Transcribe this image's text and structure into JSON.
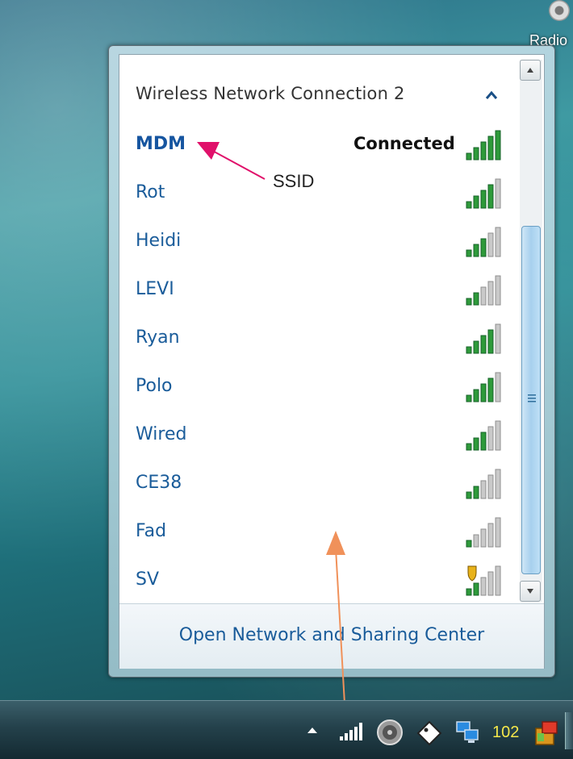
{
  "desktop": {
    "icon_label": "Radio"
  },
  "popup": {
    "section_title": "Wireless Network Connection 2",
    "networks": [
      {
        "ssid": "MDM",
        "status": "Connected",
        "bars": 5,
        "secured_shield": false,
        "connected": true
      },
      {
        "ssid": "Rot",
        "status": "",
        "bars": 4,
        "secured_shield": false,
        "connected": false
      },
      {
        "ssid": "Heidi",
        "status": "",
        "bars": 3,
        "secured_shield": false,
        "connected": false
      },
      {
        "ssid": "LEVI",
        "status": "",
        "bars": 2,
        "secured_shield": false,
        "connected": false
      },
      {
        "ssid": "Ryan",
        "status": "",
        "bars": 4,
        "secured_shield": false,
        "connected": false
      },
      {
        "ssid": "Polo",
        "status": "",
        "bars": 4,
        "secured_shield": false,
        "connected": false
      },
      {
        "ssid": "Wired",
        "status": "",
        "bars": 3,
        "secured_shield": false,
        "connected": false
      },
      {
        "ssid": "CE38",
        "status": "",
        "bars": 2,
        "secured_shield": false,
        "connected": false
      },
      {
        "ssid": "Fad",
        "status": "",
        "bars": 1,
        "secured_shield": false,
        "connected": false
      },
      {
        "ssid": "SV",
        "status": "",
        "bars": 2,
        "secured_shield": true,
        "connected": false
      }
    ],
    "footer_link": "Open Network and Sharing Center"
  },
  "annotation": {
    "label": "SSID"
  },
  "taskbar": {
    "clock_text": "102"
  },
  "colors": {
    "link_blue": "#1a5c9a",
    "signal_green": "#2e9a3a",
    "annotation_pink": "#e0106a",
    "annotation_orange": "#f0915a",
    "clock_yellow": "#f5e84a"
  },
  "icons": {
    "collapse": "chevron-up-icon",
    "signal": "signal-strength-icon",
    "shield": "security-shield-icon",
    "tray_signal": "wireless-signal-icon",
    "tray_disc": "disc-icon",
    "tray_tag": "tag-icon",
    "tray_network": "network-monitor-icon",
    "tray_app": "app-box-icon"
  }
}
